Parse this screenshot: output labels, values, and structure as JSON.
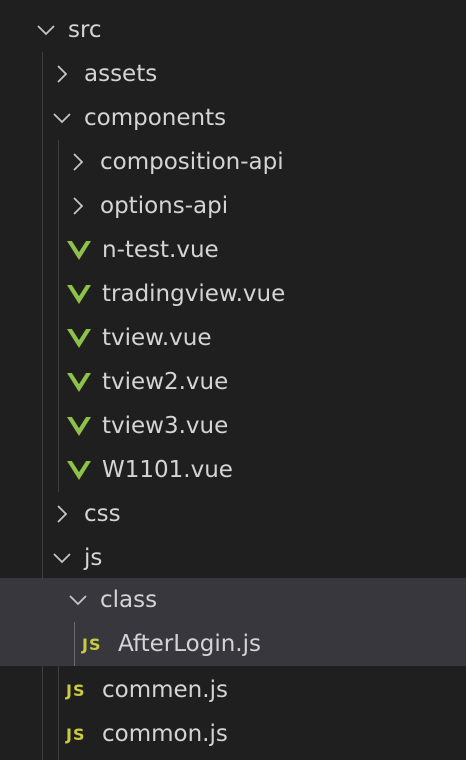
{
  "tree": {
    "src": {
      "label": "src",
      "icon": "chevron-down-icon",
      "expanded": true
    },
    "assets": {
      "label": "assets",
      "icon": "chevron-right-icon",
      "expanded": false
    },
    "components": {
      "label": "components",
      "icon": "chevron-down-icon",
      "expanded": true
    },
    "composition_api": {
      "label": "composition-api",
      "icon": "chevron-right-icon",
      "expanded": false
    },
    "options_api": {
      "label": "options-api",
      "icon": "chevron-right-icon",
      "expanded": false
    },
    "vue_files": [
      {
        "label": "n-test.vue",
        "icon": "vue-icon"
      },
      {
        "label": "tradingview.vue",
        "icon": "vue-icon"
      },
      {
        "label": "tview.vue",
        "icon": "vue-icon"
      },
      {
        "label": "tview2.vue",
        "icon": "vue-icon"
      },
      {
        "label": "tview3.vue",
        "icon": "vue-icon"
      },
      {
        "label": "W1101.vue",
        "icon": "vue-icon"
      }
    ],
    "css": {
      "label": "css",
      "icon": "chevron-right-icon",
      "expanded": false
    },
    "js": {
      "label": "js",
      "icon": "chevron-down-icon",
      "expanded": true
    },
    "class": {
      "label": "class",
      "icon": "chevron-down-icon",
      "expanded": true
    },
    "after_login": {
      "label": "AfterLogin.js",
      "icon_text": "JS"
    },
    "commen": {
      "label": "commen.js",
      "icon_text": "JS"
    },
    "common": {
      "label": "common.js",
      "icon_text": "JS"
    }
  },
  "colors": {
    "background": "#1f1f1f",
    "highlight": "#37373d",
    "text": "#d4d4d4",
    "vue_green": "#8dc149",
    "js_yellow": "#cbcb41",
    "guide_line": "#3f3f3f"
  }
}
